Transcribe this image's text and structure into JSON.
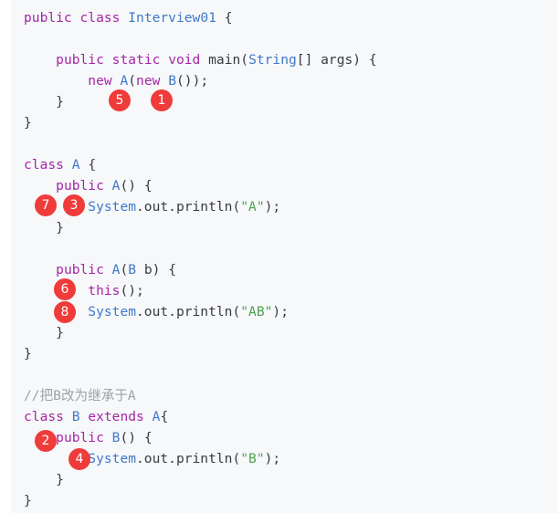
{
  "code": {
    "l1": {
      "k1": "public",
      "k2": "class",
      "cls": "Interview01",
      "rest": " {"
    },
    "l3": {
      "k1": "public",
      "k2": "static",
      "k3": "void",
      "rest1": " main(",
      "t": "String",
      "rest2": "[] args) {"
    },
    "l4": {
      "k1": "new",
      "c1": "A",
      "p1": "(",
      "k2": "new",
      "c2": "B",
      "p2": "());"
    },
    "l5": {
      "t": "}"
    },
    "l6": {
      "t": "}"
    },
    "l8": {
      "k1": "class",
      "cls": "A",
      "rest": " {"
    },
    "l9": {
      "k1": "public",
      "cls": "A",
      "rest": "() {"
    },
    "l10": {
      "cls": "System",
      "rest1": ".out.println(",
      "str": "\"A\"",
      "rest2": ");"
    },
    "l11": {
      "t": "}"
    },
    "l13": {
      "k1": "public",
      "cls": "A",
      "p1": "(",
      "c2": "B",
      "rest": " b) {"
    },
    "l14": {
      "k1": "this",
      "rest": "();"
    },
    "l15": {
      "cls": "System",
      "rest1": ".out.println(",
      "str": "\"AB\"",
      "rest2": ");"
    },
    "l16": {
      "t": "}"
    },
    "l17": {
      "t": "}"
    },
    "l19": {
      "t": "//把B改为继承于A"
    },
    "l20": {
      "k1": "class",
      "cls": "B",
      "k2": "extends",
      "cls2": "A",
      "rest": "{"
    },
    "l21": {
      "k1": "public",
      "cls": "B",
      "rest": "() {"
    },
    "l22": {
      "cls": "System",
      "rest1": ".out.println(",
      "str": "\"B\"",
      "rest2": ");"
    },
    "l23": {
      "t": "}"
    },
    "l24": {
      "t": "}"
    }
  },
  "badges": [
    "5",
    "1",
    "7",
    "3",
    "6",
    "8",
    "2",
    "4"
  ],
  "colors": {
    "keyword": "#a626a4",
    "class": "#4078c8",
    "string": "#50a14f",
    "comment": "#a0a1a7",
    "badge": "#ef3b3a",
    "background": "#f6f8fa"
  }
}
